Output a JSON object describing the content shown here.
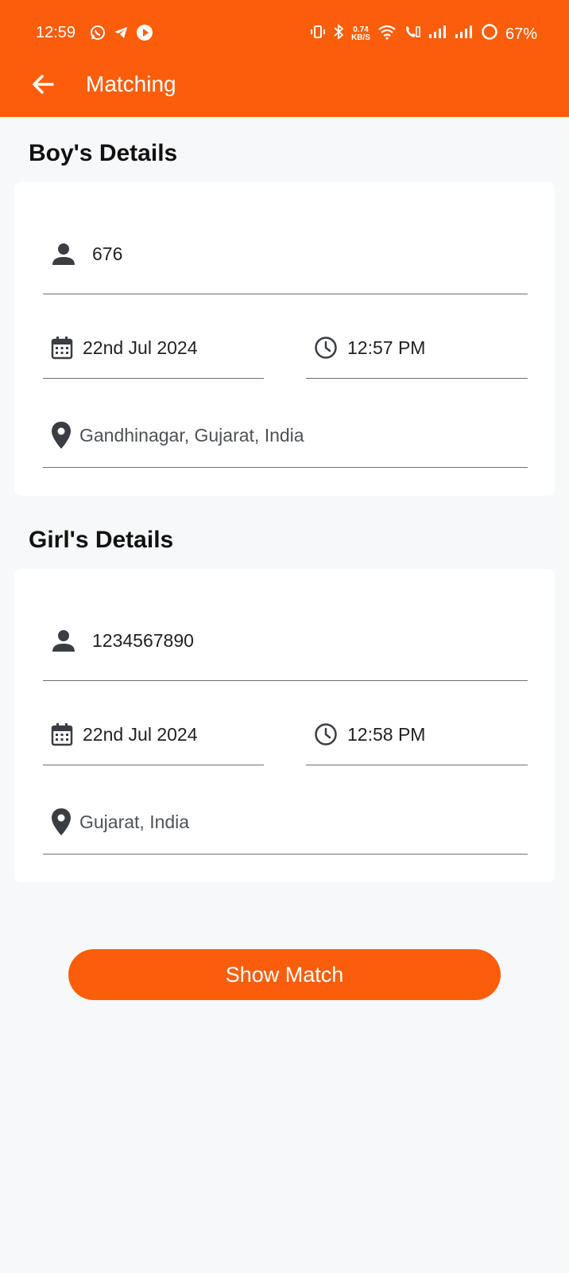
{
  "status_bar": {
    "time": "12:59",
    "speed_value": "0.74",
    "speed_unit": "KB/S",
    "battery": "67%"
  },
  "toolbar": {
    "title": "Matching",
    "back_icon": "arrow-left-icon"
  },
  "boy": {
    "heading": "Boy's Details",
    "name": "676",
    "date": "22nd Jul 2024",
    "time": "12:57 PM",
    "location": "Gandhinagar, Gujarat, India"
  },
  "girl": {
    "heading": "Girl's Details",
    "name": "1234567890",
    "date": "22nd Jul 2024",
    "time": "12:58 PM",
    "location": "Gujarat, India"
  },
  "actions": {
    "show_match": "Show Match"
  },
  "colors": {
    "brand": "#fb5e0b",
    "background": "#f7f8fa",
    "card": "#ffffff",
    "icon": "#3a3d42"
  }
}
